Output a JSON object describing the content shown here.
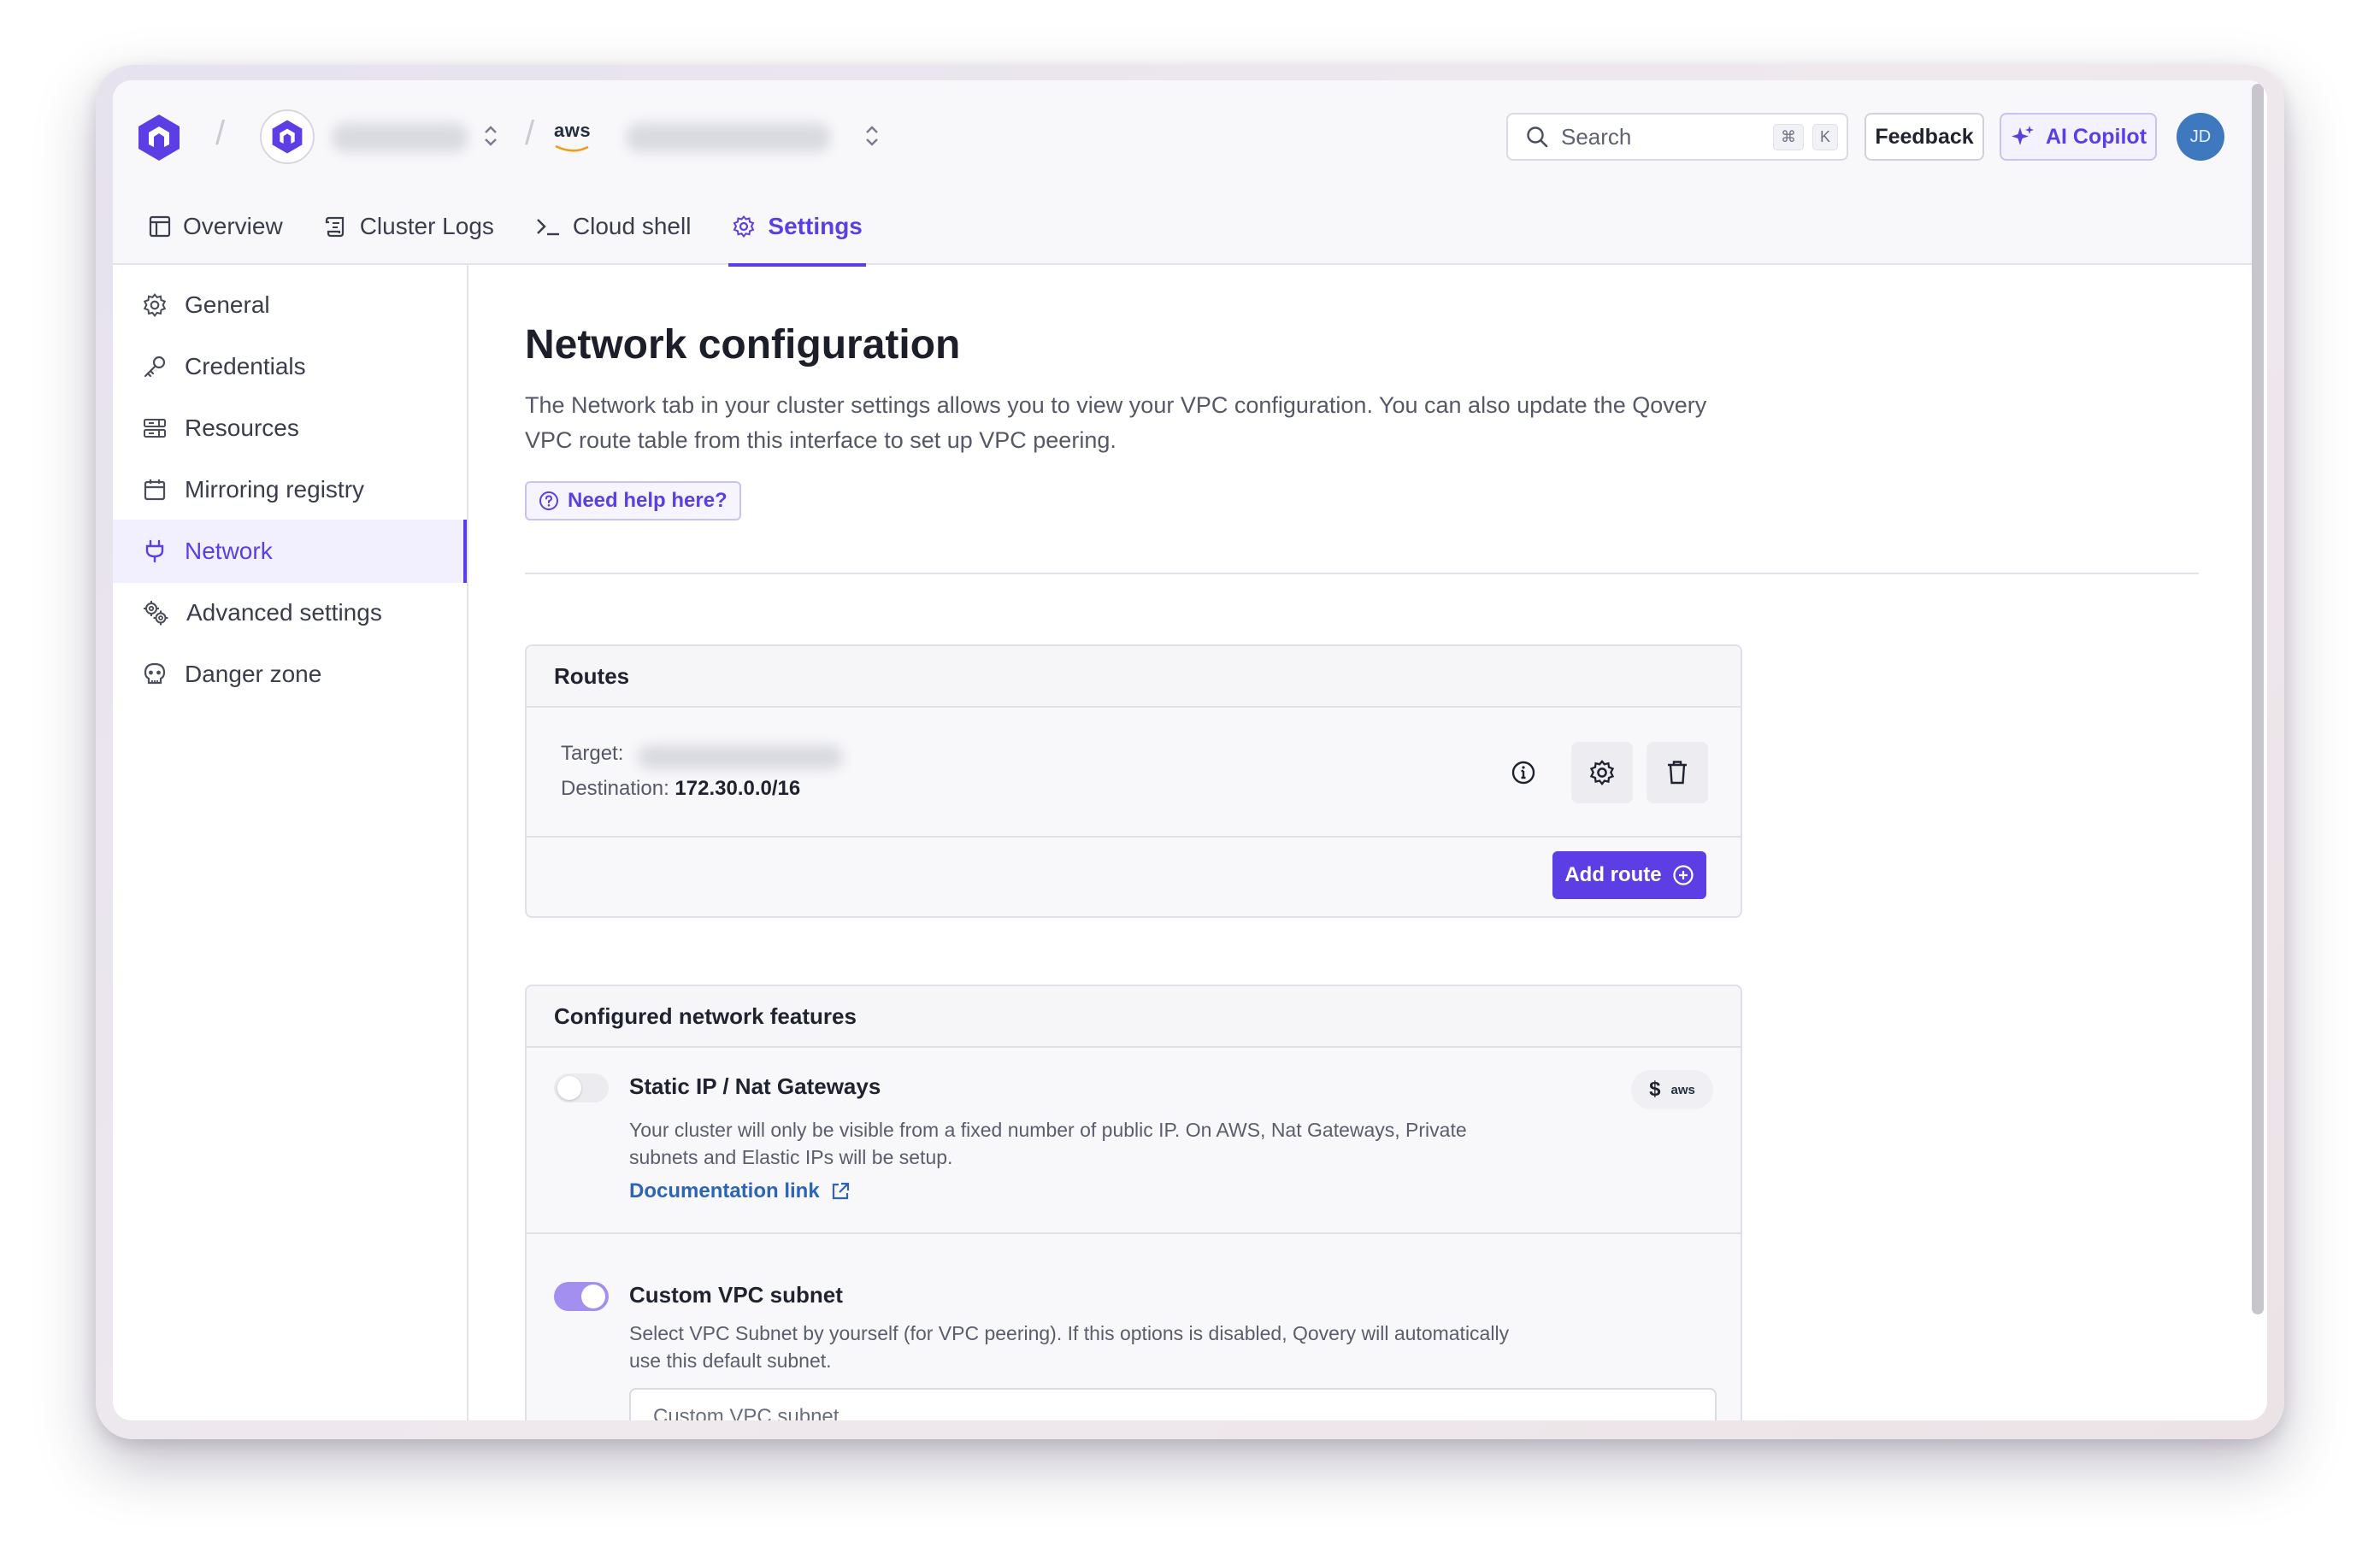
{
  "nav": {
    "cloud_provider_label": "aws"
  },
  "header": {
    "search_label": "Search",
    "search_shortcut_cmd": "⌘",
    "search_shortcut_key": "K",
    "feedback_label": "Feedback",
    "copilot_label": "AI Copilot",
    "avatar_initials": "JD"
  },
  "tabs": [
    {
      "label": "Overview",
      "icon": "layout-icon"
    },
    {
      "label": "Cluster Logs",
      "icon": "scroll-icon"
    },
    {
      "label": "Cloud shell",
      "icon": "terminal-icon"
    },
    {
      "label": "Settings",
      "icon": "gear-icon",
      "active": true
    }
  ],
  "sidebar": {
    "items": [
      {
        "label": "General",
        "icon": "gear-icon"
      },
      {
        "label": "Credentials",
        "icon": "key-icon"
      },
      {
        "label": "Resources",
        "icon": "server-icon"
      },
      {
        "label": "Mirroring registry",
        "icon": "box-icon"
      },
      {
        "label": "Network",
        "icon": "plug-icon",
        "active": true
      },
      {
        "label": "Advanced settings",
        "icon": "gears-icon"
      },
      {
        "label": "Danger zone",
        "icon": "skull-icon"
      }
    ]
  },
  "main": {
    "title": "Network configuration",
    "description": "The Network tab in your cluster settings allows you to view your VPC configuration. You can also update the Qovery VPC route table from this interface to set up VPC peering.",
    "help_label": "Need help here?",
    "routes": {
      "title": "Routes",
      "target_label": "Target:",
      "destination_label": "Destination:",
      "destination_value": "172.30.0.0/16",
      "add_label": "Add route"
    },
    "features": {
      "title": "Configured network features",
      "static_ip": {
        "title": "Static IP / Nat Gateways",
        "description": "Your cluster will only be visible from a fixed number of public IP. On AWS, Nat Gateways, Private subnets and Elastic IPs will be setup.",
        "doc_label": "Documentation link",
        "badge_currency": "$",
        "badge_provider": "aws",
        "enabled": false
      },
      "custom_vpc": {
        "title": "Custom VPC subnet",
        "description": "Select VPC Subnet by yourself (for VPC peering). If this options is disabled, Qovery will automatically use this default subnet.",
        "input_placeholder": "Custom VPC subnet",
        "enabled": true
      }
    }
  },
  "colors": {
    "accent": "#5b3fe5",
    "link": "#2c64b8",
    "avatar": "#3e78be"
  }
}
